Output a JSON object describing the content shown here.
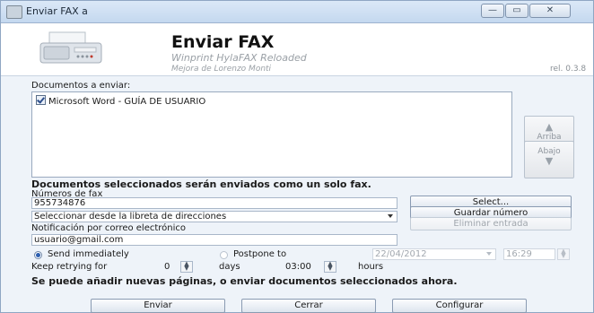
{
  "window": {
    "title": "Enviar FAX a",
    "min_glyph": "—",
    "max_glyph": "▭",
    "close_glyph": "✕"
  },
  "header": {
    "app_name": "Enviar FAX",
    "subtitle": "Winprint HylaFAX Reloaded",
    "credit": "Mejora de Lorenzo Monti",
    "version": "rel. 0.3.8"
  },
  "documents": {
    "label": "Documentos a enviar:",
    "items": [
      {
        "checked": true,
        "name": "Microsoft Word - GUÍA DE USUARIO"
      }
    ],
    "up_button": {
      "arrow": "▲",
      "label": "Arriba"
    },
    "down_button": {
      "label": "Abajo",
      "arrow": "▼"
    },
    "note": "Documentos seleccionados serán enviados como un solo fax."
  },
  "fax": {
    "numbers_label": "Números de fax",
    "number_value": "955734876",
    "addressbook_select": "Seleccionar desde la libreta de direcciones",
    "select_button": "Select...",
    "save_number_button": "Guardar número",
    "delete_entry_button": "Eliminar entrada",
    "email_label": "Notificación por correo electrónico",
    "email_value": "usuario@gmail.com"
  },
  "schedule": {
    "send_immediately": "Send immediately",
    "send_immediately_selected": true,
    "postpone": "Postpone to",
    "postpone_date": "22/04/2012",
    "postpone_time": "16:29",
    "keep_retrying_label": "Keep retrying for",
    "retry_days": "0",
    "days_label": "days",
    "retry_hours": "03:00",
    "hours_label": "hours",
    "spin_up": "▲",
    "spin_down": "▼",
    "combo_arrow": "▼"
  },
  "footer": {
    "note": "Se puede añadir nuevas páginas, o enviar documentos seleccionados ahora.",
    "send_button": "Enviar",
    "close_button": "Cerrar",
    "configure_button": "Configurar"
  },
  "colors": {
    "accent": "#2d5fb0",
    "window_bg": "#eef3f9",
    "disabled_text": "#a0a6ad"
  },
  "icons": [
    "fax-machine-icon",
    "window-icon"
  ]
}
